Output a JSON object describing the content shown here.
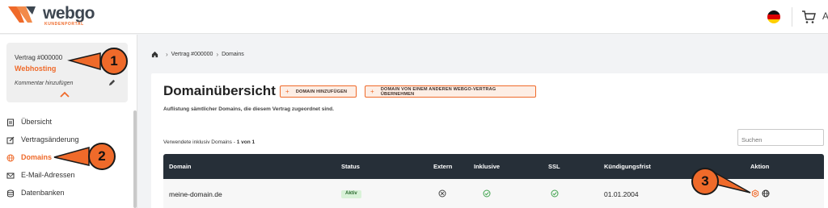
{
  "header": {
    "logo_word": "webgo",
    "logo_sub": "KUNDENPORTAL",
    "brand_color": "#ef6a2a",
    "language_flag": "de-flag-icon",
    "cart_icon": "cart-icon",
    "cut_text": "A"
  },
  "sidebar": {
    "contract": {
      "label": "Vertrag  #000000",
      "product": "Webhosting",
      "comment": "Kommentar hinzufügen"
    },
    "items": [
      {
        "label": "Übersicht",
        "icon": "overview-icon"
      },
      {
        "label": "Vertragsänderung",
        "icon": "edit-contract-icon"
      },
      {
        "label": "Domains",
        "icon": "globe-icon",
        "active": true
      },
      {
        "label": "E-Mail-Adressen",
        "icon": "email-icon"
      },
      {
        "label": "Datenbanken",
        "icon": "database-icon"
      }
    ]
  },
  "breadcrumb": {
    "items": [
      "Vertrag #000000",
      "Domains"
    ]
  },
  "main": {
    "title": "Domainübersicht",
    "btn_add": "DOMAIN HINZUFÜGEN",
    "btn_transfer": "DOMAIN VON EINEM ANDEREN WEBGO-VERTRAG ÜBERNEHMEN",
    "subtitle": "Auflistung sämtlicher Domains, die diesem Vertrag zugeordnet sind.",
    "search_placeholder": "Suchen",
    "count_prefix": "Verwendete inklusiv Domains - ",
    "count_value": "1 von 1"
  },
  "table": {
    "columns": [
      "Domain",
      "Status",
      "Extern",
      "Inklusive",
      "SSL",
      "Kündigungsfrist",
      "Aktion"
    ],
    "rows": [
      {
        "domain": "meine-domain.de",
        "status": "Aktiv",
        "extern": "x-circle-icon",
        "inklusive": "check-circle-icon",
        "ssl": "check-circle-icon",
        "kuendigungsfrist": "01.01.2004",
        "actions": [
          "settings-icon",
          "globe-icon"
        ]
      }
    ]
  },
  "callouts": [
    "1",
    "2",
    "3"
  ]
}
